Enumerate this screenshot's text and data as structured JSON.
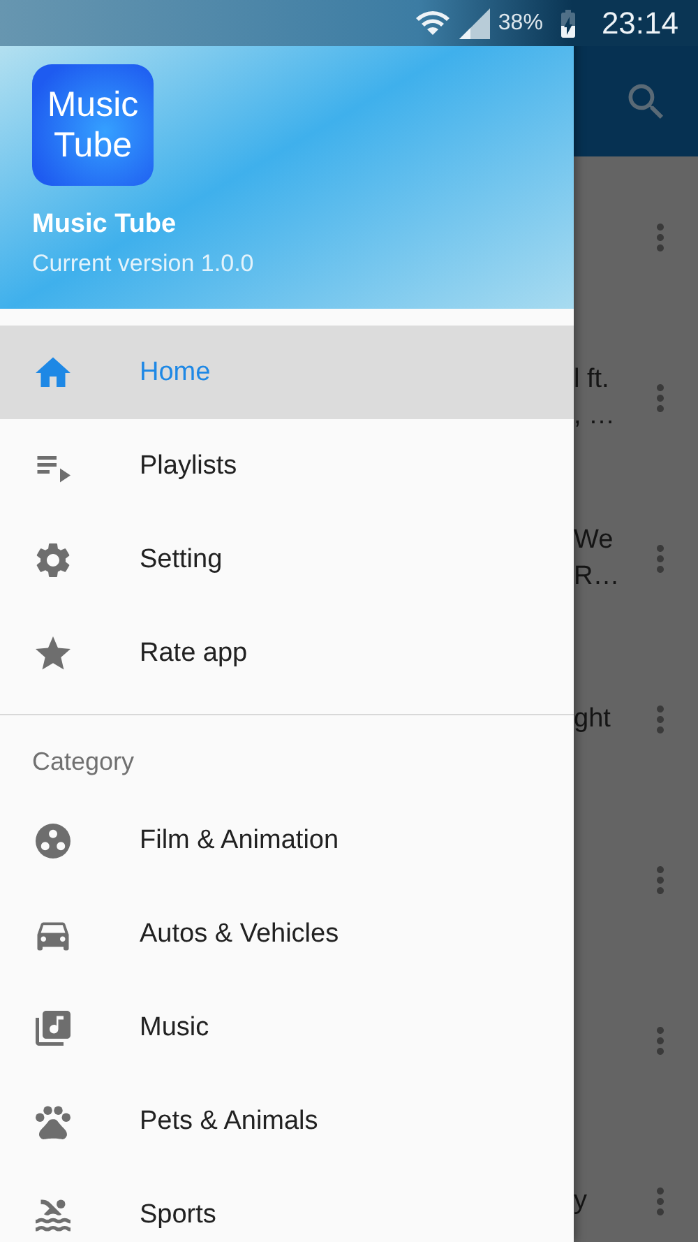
{
  "status_bar": {
    "battery": "38%",
    "time": "23:14"
  },
  "background_list": {
    "rows": [
      {
        "lines": []
      },
      {
        "lines": [
          "l ft.",
          ", …"
        ]
      },
      {
        "lines": [
          "We",
          "R…"
        ]
      },
      {
        "lines": [
          "ght"
        ]
      },
      {
        "lines": []
      },
      {
        "lines": []
      },
      {
        "lines": [
          "y"
        ]
      }
    ]
  },
  "drawer": {
    "header": {
      "logo_text": "Music Tube",
      "title": "Music Tube",
      "subtitle": "Current version 1.0.0"
    },
    "menu": [
      {
        "label": "Home",
        "selected": true
      },
      {
        "label": "Playlists",
        "selected": false
      },
      {
        "label": "Setting",
        "selected": false
      },
      {
        "label": "Rate app",
        "selected": false
      }
    ],
    "category_heading": "Category",
    "categories": [
      {
        "label": "Film & Animation"
      },
      {
        "label": "Autos & Vehicles"
      },
      {
        "label": "Music"
      },
      {
        "label": "Pets & Animals"
      },
      {
        "label": "Sports"
      }
    ]
  }
}
